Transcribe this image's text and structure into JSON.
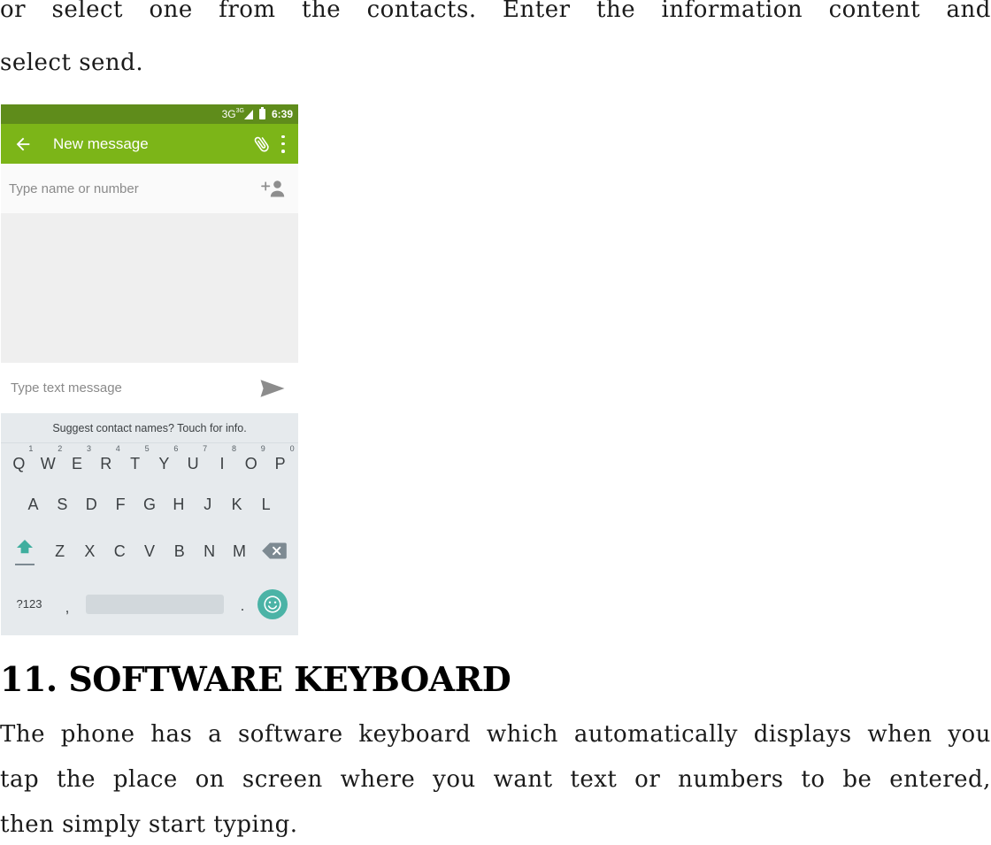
{
  "document": {
    "top_paragraph": {
      "line1_words": [
        "or",
        "select",
        "one",
        "from",
        "the",
        "contacts.",
        "Enter",
        "the",
        "information",
        "content",
        "and"
      ],
      "line2": "select send."
    },
    "heading": "11. SOFTWARE KEYBOARD",
    "body_paragraph": {
      "line1_words": [
        "The",
        "phone",
        "has",
        "a",
        "software",
        "keyboard",
        "which",
        "automatically",
        "displays",
        "when",
        "you"
      ],
      "line2_words": [
        "tap",
        "the",
        "place",
        "on",
        "screen",
        "where",
        "you",
        "want",
        "text",
        "or",
        "numbers",
        "to",
        "be",
        "entered,"
      ],
      "line3": "then simply start typing."
    }
  },
  "phone": {
    "status_bar": {
      "network": "3G",
      "network_sup": "3G",
      "time": "6:39",
      "background": "#5f8c1b"
    },
    "app_bar": {
      "title": "New message",
      "background": "#7cb518",
      "back_icon": "back-arrow-icon",
      "attach_icon": "paperclip-icon",
      "overflow_icon": "overflow-menu-icon"
    },
    "recipient": {
      "placeholder": "Type name or number",
      "add_contact_icon": "add-contact-icon"
    },
    "compose": {
      "placeholder": "Type text message",
      "send_icon": "send-icon"
    },
    "keyboard": {
      "suggestion": "Suggest contact names? Touch for info.",
      "background": "#e6eaed",
      "accent": "#4bb3a6",
      "row1": [
        {
          "letter": "Q",
          "num": "1"
        },
        {
          "letter": "W",
          "num": "2"
        },
        {
          "letter": "E",
          "num": "3"
        },
        {
          "letter": "R",
          "num": "4"
        },
        {
          "letter": "T",
          "num": "5"
        },
        {
          "letter": "Y",
          "num": "6"
        },
        {
          "letter": "U",
          "num": "7"
        },
        {
          "letter": "I",
          "num": "8"
        },
        {
          "letter": "O",
          "num": "9"
        },
        {
          "letter": "P",
          "num": "0"
        }
      ],
      "row2": [
        "A",
        "S",
        "D",
        "F",
        "G",
        "H",
        "J",
        "K",
        "L"
      ],
      "row3": [
        "Z",
        "X",
        "C",
        "V",
        "B",
        "N",
        "M"
      ],
      "shift_icon": "shift-arrow-icon",
      "backspace_icon": "backspace-icon",
      "row4": {
        "symbols_label": "?123",
        "comma": ",",
        "period": ".",
        "space_label": "",
        "emoji_icon": "emoji-smiley-icon"
      }
    }
  }
}
